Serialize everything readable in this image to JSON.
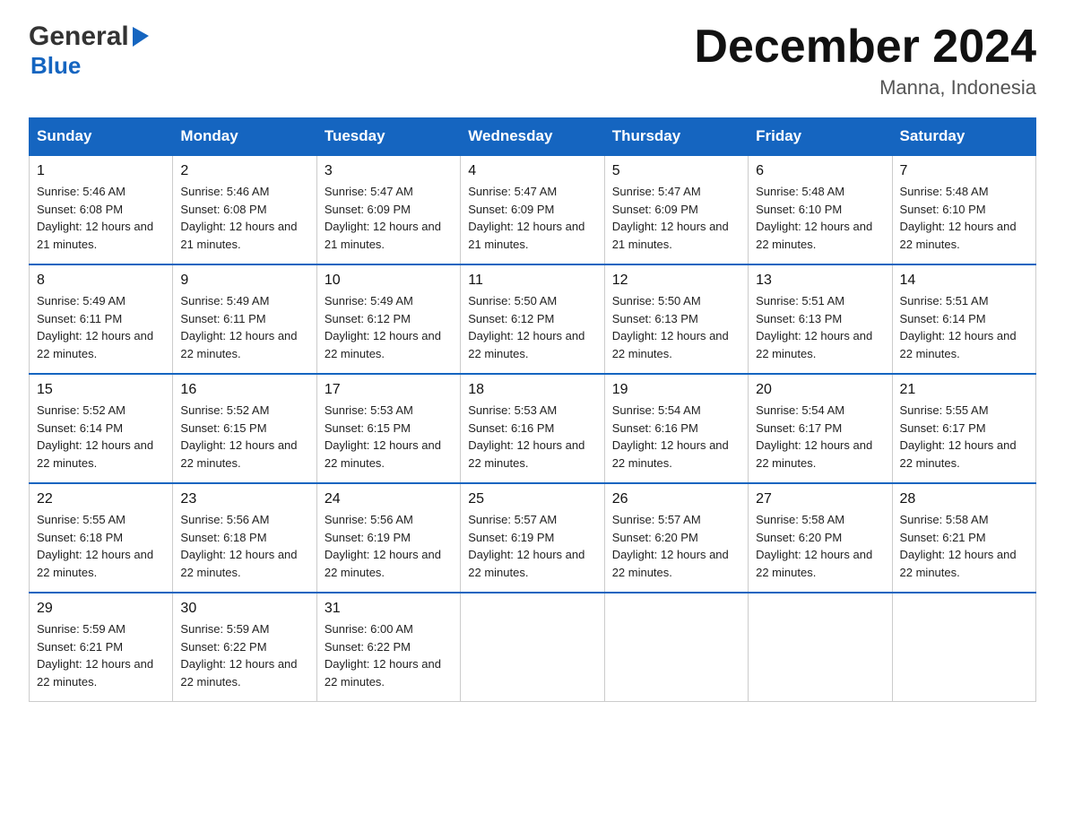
{
  "logo": {
    "general": "General",
    "blue": "Blue",
    "triangle": "▶"
  },
  "title": "December 2024",
  "subtitle": "Manna, Indonesia",
  "weekdays": [
    "Sunday",
    "Monday",
    "Tuesday",
    "Wednesday",
    "Thursday",
    "Friday",
    "Saturday"
  ],
  "weeks": [
    [
      {
        "day": "1",
        "sunrise": "5:46 AM",
        "sunset": "6:08 PM",
        "daylight": "12 hours and 21 minutes."
      },
      {
        "day": "2",
        "sunrise": "5:46 AM",
        "sunset": "6:08 PM",
        "daylight": "12 hours and 21 minutes."
      },
      {
        "day": "3",
        "sunrise": "5:47 AM",
        "sunset": "6:09 PM",
        "daylight": "12 hours and 21 minutes."
      },
      {
        "day": "4",
        "sunrise": "5:47 AM",
        "sunset": "6:09 PM",
        "daylight": "12 hours and 21 minutes."
      },
      {
        "day": "5",
        "sunrise": "5:47 AM",
        "sunset": "6:09 PM",
        "daylight": "12 hours and 21 minutes."
      },
      {
        "day": "6",
        "sunrise": "5:48 AM",
        "sunset": "6:10 PM",
        "daylight": "12 hours and 22 minutes."
      },
      {
        "day": "7",
        "sunrise": "5:48 AM",
        "sunset": "6:10 PM",
        "daylight": "12 hours and 22 minutes."
      }
    ],
    [
      {
        "day": "8",
        "sunrise": "5:49 AM",
        "sunset": "6:11 PM",
        "daylight": "12 hours and 22 minutes."
      },
      {
        "day": "9",
        "sunrise": "5:49 AM",
        "sunset": "6:11 PM",
        "daylight": "12 hours and 22 minutes."
      },
      {
        "day": "10",
        "sunrise": "5:49 AM",
        "sunset": "6:12 PM",
        "daylight": "12 hours and 22 minutes."
      },
      {
        "day": "11",
        "sunrise": "5:50 AM",
        "sunset": "6:12 PM",
        "daylight": "12 hours and 22 minutes."
      },
      {
        "day": "12",
        "sunrise": "5:50 AM",
        "sunset": "6:13 PM",
        "daylight": "12 hours and 22 minutes."
      },
      {
        "day": "13",
        "sunrise": "5:51 AM",
        "sunset": "6:13 PM",
        "daylight": "12 hours and 22 minutes."
      },
      {
        "day": "14",
        "sunrise": "5:51 AM",
        "sunset": "6:14 PM",
        "daylight": "12 hours and 22 minutes."
      }
    ],
    [
      {
        "day": "15",
        "sunrise": "5:52 AM",
        "sunset": "6:14 PM",
        "daylight": "12 hours and 22 minutes."
      },
      {
        "day": "16",
        "sunrise": "5:52 AM",
        "sunset": "6:15 PM",
        "daylight": "12 hours and 22 minutes."
      },
      {
        "day": "17",
        "sunrise": "5:53 AM",
        "sunset": "6:15 PM",
        "daylight": "12 hours and 22 minutes."
      },
      {
        "day": "18",
        "sunrise": "5:53 AM",
        "sunset": "6:16 PM",
        "daylight": "12 hours and 22 minutes."
      },
      {
        "day": "19",
        "sunrise": "5:54 AM",
        "sunset": "6:16 PM",
        "daylight": "12 hours and 22 minutes."
      },
      {
        "day": "20",
        "sunrise": "5:54 AM",
        "sunset": "6:17 PM",
        "daylight": "12 hours and 22 minutes."
      },
      {
        "day": "21",
        "sunrise": "5:55 AM",
        "sunset": "6:17 PM",
        "daylight": "12 hours and 22 minutes."
      }
    ],
    [
      {
        "day": "22",
        "sunrise": "5:55 AM",
        "sunset": "6:18 PM",
        "daylight": "12 hours and 22 minutes."
      },
      {
        "day": "23",
        "sunrise": "5:56 AM",
        "sunset": "6:18 PM",
        "daylight": "12 hours and 22 minutes."
      },
      {
        "day": "24",
        "sunrise": "5:56 AM",
        "sunset": "6:19 PM",
        "daylight": "12 hours and 22 minutes."
      },
      {
        "day": "25",
        "sunrise": "5:57 AM",
        "sunset": "6:19 PM",
        "daylight": "12 hours and 22 minutes."
      },
      {
        "day": "26",
        "sunrise": "5:57 AM",
        "sunset": "6:20 PM",
        "daylight": "12 hours and 22 minutes."
      },
      {
        "day": "27",
        "sunrise": "5:58 AM",
        "sunset": "6:20 PM",
        "daylight": "12 hours and 22 minutes."
      },
      {
        "day": "28",
        "sunrise": "5:58 AM",
        "sunset": "6:21 PM",
        "daylight": "12 hours and 22 minutes."
      }
    ],
    [
      {
        "day": "29",
        "sunrise": "5:59 AM",
        "sunset": "6:21 PM",
        "daylight": "12 hours and 22 minutes."
      },
      {
        "day": "30",
        "sunrise": "5:59 AM",
        "sunset": "6:22 PM",
        "daylight": "12 hours and 22 minutes."
      },
      {
        "day": "31",
        "sunrise": "6:00 AM",
        "sunset": "6:22 PM",
        "daylight": "12 hours and 22 minutes."
      },
      null,
      null,
      null,
      null
    ]
  ]
}
